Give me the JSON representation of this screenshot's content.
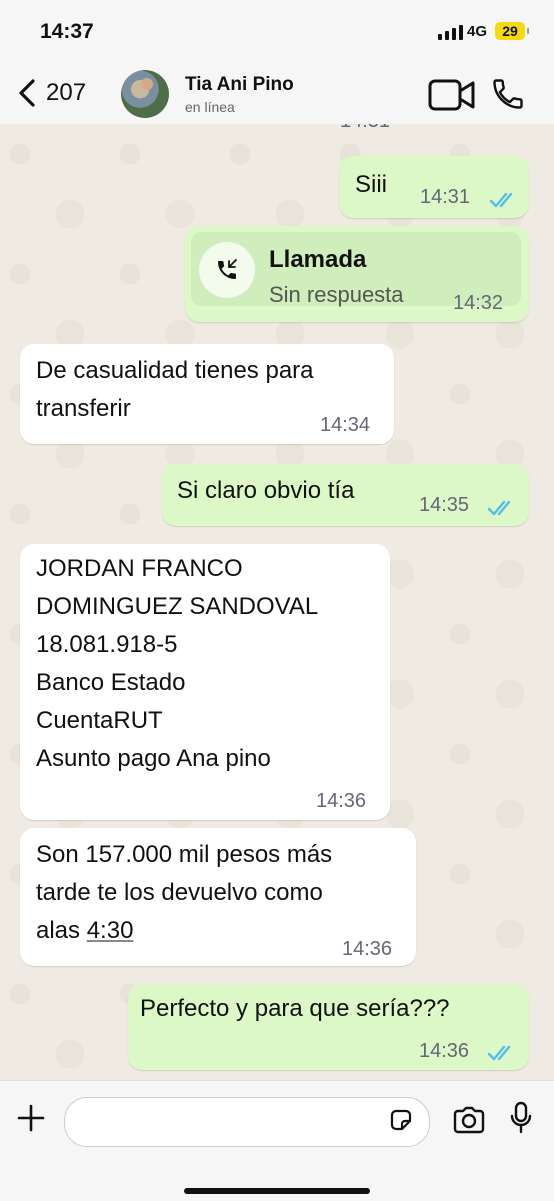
{
  "status_bar": {
    "time": "14:37",
    "network": "4G",
    "battery": "29"
  },
  "header": {
    "back_count": "207",
    "contact_name": "Tia Ani Pino",
    "contact_status": "en línea"
  },
  "chat": {
    "partial_time": "14:31",
    "messages": [
      {
        "dir": "out",
        "text": "Siii",
        "time": "14:31",
        "read": true
      },
      {
        "dir": "out",
        "type": "call",
        "title": "Llamada",
        "subtitle": "Sin respuesta",
        "time": "14:32"
      },
      {
        "dir": "in",
        "text": "De casualidad tienes para\ntransferir",
        "time": "14:34"
      },
      {
        "dir": "out",
        "text": "Si claro obvio tía",
        "time": "14:35",
        "read": true
      },
      {
        "dir": "in",
        "text": "JORDAN FRANCO\nDOMINGUEZ SANDOVAL\n18.081.918-5\nBanco Estado\nCuentaRUT\nAsunto pago Ana pino",
        "time": "14:36"
      },
      {
        "dir": "in",
        "text_a": "Son 157.000 mil pesos más\ntarde te los devuelvo como\nalas ",
        "link": "4:30",
        "time": "14:36"
      },
      {
        "dir": "out",
        "text": "Perfecto  y para que sería???",
        "time": "14:36",
        "read": true
      }
    ]
  },
  "input": {
    "placeholder": ""
  },
  "colors": {
    "outgoing": "#dcf8c6",
    "incoming": "#ffffff",
    "read_ticks": "#53bdeb"
  },
  "icons": [
    "chevron-left-icon",
    "video-call-icon",
    "phone-icon",
    "missed-call-icon",
    "plus-icon",
    "sticker-icon",
    "camera-icon",
    "mic-icon",
    "double-check-icon"
  ]
}
